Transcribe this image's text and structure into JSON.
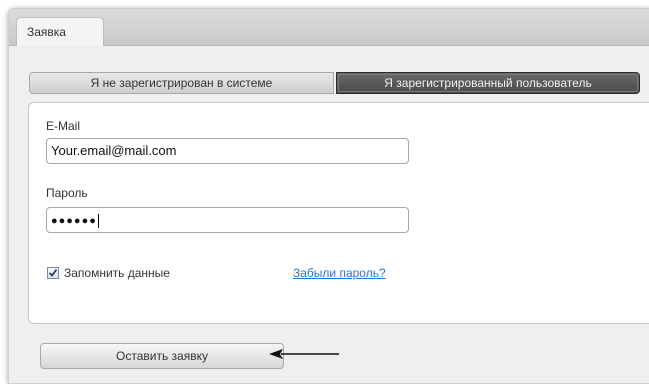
{
  "main_tab": {
    "label": "Заявка"
  },
  "auth_toggle": {
    "unregistered_label": "Я не зарегистрирован в системе",
    "registered_label": "Я зарегистрированный пользователь",
    "selected": "registered"
  },
  "form": {
    "email_label": "E-Mail",
    "email_value": "Your.email@mail.com",
    "password_label": "Пароль",
    "password_masked": "●●●●●●",
    "remember_label": "Запомнить данные",
    "remember_checked": true,
    "forgot_link": "Забыли пароль?"
  },
  "actions": {
    "submit_label": "Оставить заявку"
  },
  "icons": {
    "checkbox_mark": "checkmark-icon",
    "pointer": "arrow-left-icon"
  },
  "colors": {
    "link": "#1e7bd1",
    "selected_segment": "#555555"
  }
}
